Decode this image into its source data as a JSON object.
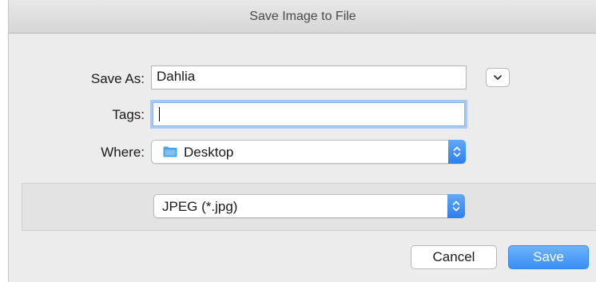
{
  "window": {
    "title": "Save Image to File"
  },
  "form": {
    "save_as_label": "Save As:",
    "save_as_value": "Dahlia",
    "tags_label": "Tags:",
    "tags_value": "",
    "where_label": "Where:",
    "where_value": "Desktop",
    "where_icon": "folder-icon"
  },
  "format": {
    "selected": "JPEG (*.jpg)"
  },
  "buttons": {
    "cancel_label": "Cancel",
    "save_label": "Save"
  },
  "colors": {
    "accent": "#3a8ef5",
    "focus_ring": "#a9c9f3",
    "folder": "#4da3e6"
  }
}
